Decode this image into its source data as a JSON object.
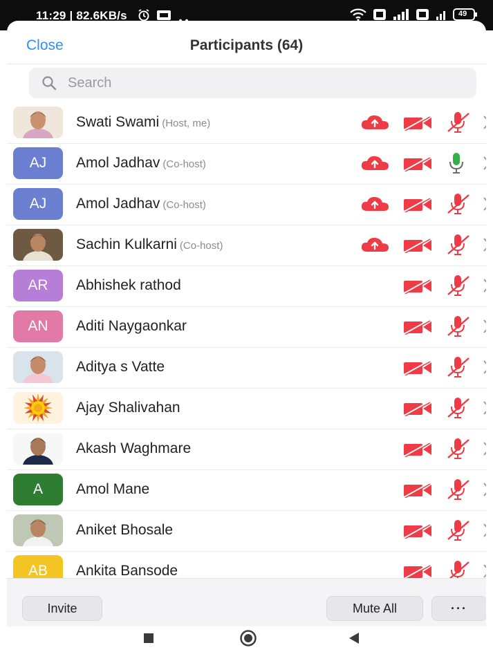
{
  "status_bar": {
    "time": "11:29 | 82.6KB/s",
    "icons": [
      "alarm-icon",
      "screenshot-icon",
      "more-dots-icon",
      "wifi-icon",
      "sim-icon",
      "signal-icon",
      "battery-icon"
    ],
    "battery": "49"
  },
  "header": {
    "close_label": "Close",
    "title": "Participants (64)"
  },
  "search": {
    "placeholder": "Search"
  },
  "colors": {
    "accent": "#2d8cff",
    "muted_red": "#ee3b46",
    "unmuted_green": "#34b24a"
  },
  "participants": [
    {
      "name": "Swati Swami",
      "role": "(Host, me)",
      "avatar_type": "photo",
      "cloud": true,
      "mic": "muted"
    },
    {
      "name": "Amol Jadhav",
      "role": "(Co-host)",
      "avatar_type": "initials",
      "initials": "AJ",
      "avatar_color": "#6b7fd0",
      "cloud": true,
      "mic": "unmuted"
    },
    {
      "name": "Amol Jadhav",
      "role": "(Co-host)",
      "avatar_type": "initials",
      "initials": "AJ",
      "avatar_color": "#6b7fd0",
      "cloud": true,
      "mic": "muted"
    },
    {
      "name": "Sachin Kulkarni",
      "role": "(Co-host)",
      "avatar_type": "photo",
      "cloud": true,
      "mic": "muted"
    },
    {
      "name": "Abhishek rathod",
      "role": "",
      "avatar_type": "initials",
      "initials": "AR",
      "avatar_color": "#b77ed8",
      "cloud": false,
      "mic": "muted"
    },
    {
      "name": "Aditi Naygaonkar",
      "role": "",
      "avatar_type": "initials",
      "initials": "AN",
      "avatar_color": "#e27aa8",
      "cloud": false,
      "mic": "muted"
    },
    {
      "name": "Aditya s Vatte",
      "role": "",
      "avatar_type": "photo",
      "cloud": false,
      "mic": "muted"
    },
    {
      "name": "Ajay Shalivahan",
      "role": "",
      "avatar_type": "photo",
      "cloud": false,
      "mic": "muted"
    },
    {
      "name": "Akash Waghmare",
      "role": "",
      "avatar_type": "photo",
      "cloud": false,
      "mic": "muted"
    },
    {
      "name": "Amol Mane",
      "role": "",
      "avatar_type": "initials",
      "initials": "A",
      "avatar_color": "#2e7d32",
      "cloud": false,
      "mic": "muted"
    },
    {
      "name": "Aniket Bhosale",
      "role": "",
      "avatar_type": "photo",
      "cloud": false,
      "mic": "muted"
    },
    {
      "name": "Ankita Bansode",
      "role": "",
      "avatar_type": "initials",
      "initials": "AB",
      "avatar_color": "#f2c522",
      "cloud": false,
      "mic": "muted"
    }
  ],
  "footer": {
    "invite_label": "Invite",
    "mute_all_label": "Mute All",
    "more_label": "···"
  },
  "nav_bar": {
    "icons": [
      "recent-apps-icon",
      "home-icon",
      "back-icon"
    ]
  }
}
